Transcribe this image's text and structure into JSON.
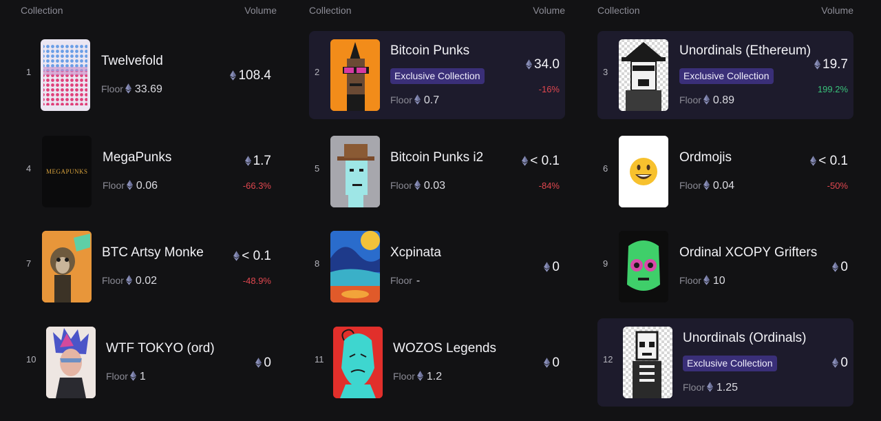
{
  "header": {
    "collection_label": "Collection",
    "volume_label": "Volume"
  },
  "colors": {
    "highlight_row": "#1d1b2c",
    "badge_bg": "#3a2f78",
    "negative": "#e0474f",
    "positive": "#39c27a",
    "eth_icon": "#8a8fb8"
  },
  "items": [
    {
      "rank": "1",
      "name": "Twelvefold",
      "floor_label": "Floor",
      "floor": "33.69",
      "volume": "108.4",
      "change": "",
      "exclusive": "",
      "thumb_icon": "twelvefold-thumbnail"
    },
    {
      "rank": "2",
      "name": "Bitcoin Punks",
      "floor_label": "Floor",
      "floor": "0.7",
      "volume": "34.0",
      "change": "-16%",
      "exclusive": "Exclusive Collection",
      "thumb_icon": "bitcoin-punks-thumbnail"
    },
    {
      "rank": "3",
      "name": "Unordinals (Ethereum)",
      "floor_label": "Floor",
      "floor": "0.89",
      "volume": "19.7",
      "change": "199.2%",
      "exclusive": "Exclusive Collection",
      "thumb_icon": "unordinals-eth-thumbnail"
    },
    {
      "rank": "4",
      "name": "MegaPunks",
      "floor_label": "Floor",
      "floor": "0.06",
      "volume": "1.7",
      "change": "-66.3%",
      "exclusive": "",
      "thumb_icon": "megapunks-thumbnail",
      "thumb_text": "MEGAPUNKS"
    },
    {
      "rank": "5",
      "name": "Bitcoin Punks i2",
      "floor_label": "Floor",
      "floor": "0.03",
      "volume": "< 0.1",
      "change": "-84%",
      "exclusive": "",
      "thumb_icon": "bitcoin-punks-i2-thumbnail"
    },
    {
      "rank": "6",
      "name": "Ordmojis",
      "floor_label": "Floor",
      "floor": "0.04",
      "volume": "< 0.1",
      "change": "-50%",
      "exclusive": "",
      "thumb_icon": "ordmojis-thumbnail"
    },
    {
      "rank": "7",
      "name": "BTC Artsy Monke",
      "floor_label": "Floor",
      "floor": "0.02",
      "volume": "< 0.1",
      "change": "-48.9%",
      "exclusive": "",
      "thumb_icon": "btc-artsy-monke-thumbnail"
    },
    {
      "rank": "8",
      "name": "Xcpinata",
      "floor_label": "Floor",
      "floor": "-",
      "volume": "0",
      "change": "",
      "exclusive": "",
      "thumb_icon": "xcpinata-thumbnail"
    },
    {
      "rank": "9",
      "name": "Ordinal XCOPY Grifters",
      "floor_label": "Floor",
      "floor": "10",
      "volume": "0",
      "change": "",
      "exclusive": "",
      "thumb_icon": "xcopy-grifters-thumbnail"
    },
    {
      "rank": "10",
      "name": "WTF TOKYO (ord)",
      "floor_label": "Floor",
      "floor": "1",
      "volume": "0",
      "change": "",
      "exclusive": "",
      "thumb_icon": "wtf-tokyo-thumbnail"
    },
    {
      "rank": "11",
      "name": "WOZOS Legends",
      "floor_label": "Floor",
      "floor": "1.2",
      "volume": "0",
      "change": "",
      "exclusive": "",
      "thumb_icon": "wozos-legends-thumbnail"
    },
    {
      "rank": "12",
      "name": "Unordinals (Ordinals)",
      "floor_label": "Floor",
      "floor": "1.25",
      "volume": "0",
      "change": "",
      "exclusive": "Exclusive Collection",
      "thumb_icon": "unordinals-ord-thumbnail"
    }
  ]
}
